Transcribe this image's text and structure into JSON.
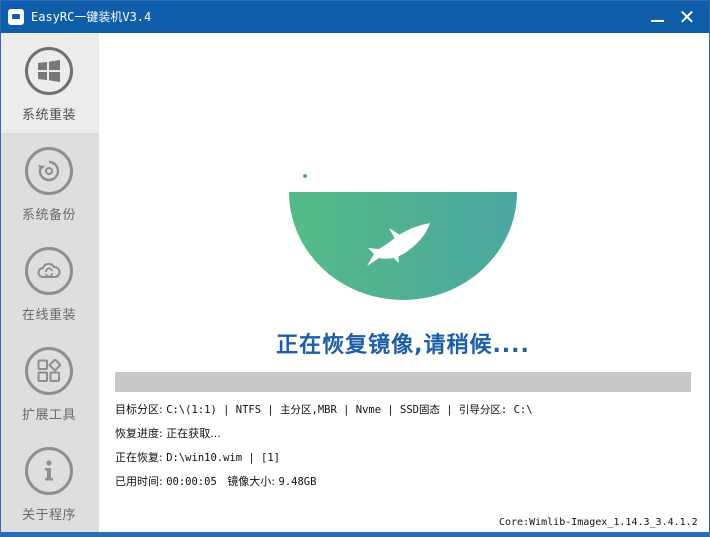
{
  "window": {
    "title": "EasyRC一键装机V3.4",
    "minimize_glyph": "",
    "close_glyph": "✕"
  },
  "sidebar": {
    "items": [
      {
        "label": "系统重装",
        "icon": "windows-icon",
        "active": true
      },
      {
        "label": "系统备份",
        "icon": "backup-icon",
        "active": false
      },
      {
        "label": "在线重装",
        "icon": "cloud-sync-icon",
        "active": false
      },
      {
        "label": "扩展工具",
        "icon": "tools-grid-icon",
        "active": false
      },
      {
        "label": "关于程序",
        "icon": "info-icon",
        "active": false
      }
    ]
  },
  "main": {
    "status_title": "正在恢复镜像,请稍候....",
    "progress_percent": 0,
    "info": {
      "target_label": "目标分区:",
      "target_value": "C:\\(1:1) | NTFS | 主分区,MBR | Nvme | SSD固态 | 引导分区: C:\\",
      "progress_label": "恢复进度:",
      "progress_value": "正在获取...",
      "restoring_label": "正在恢复:",
      "restoring_value": "D:\\win10.wim | [1]",
      "elapsed_label": "已用时间:",
      "elapsed_value": "00:00:05",
      "size_label": "镜像大小:",
      "size_value": "9.48GB"
    },
    "core_version": "Core:Wimlib-Imagex_1.14.3_3.4.1.2"
  },
  "colors": {
    "titlebar": "#0f5eaa",
    "accent_text": "#1c5fa8",
    "logo_green": "#4fb88a",
    "logo_teal": "#4aa7a0"
  }
}
